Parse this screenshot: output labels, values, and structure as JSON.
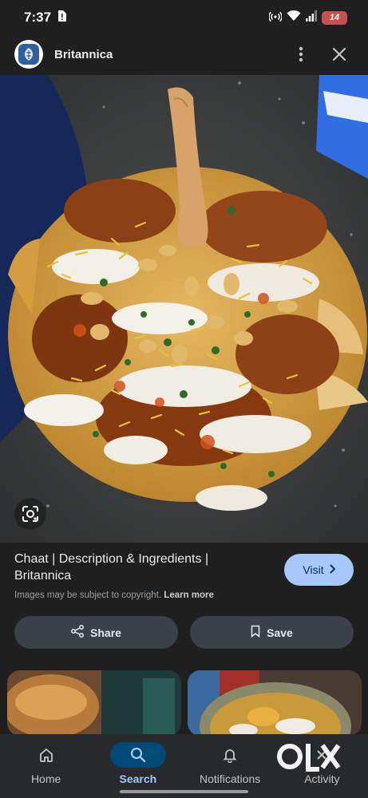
{
  "status_bar": {
    "time": "7:37",
    "battery_level": "14"
  },
  "header": {
    "site_name": "Britannica"
  },
  "result": {
    "title": "Chaat | Description & Ingredients | Britannica",
    "visit_label": "Visit",
    "copyright_text": "Images may be subject to copyright.",
    "learn_more_label": "Learn more"
  },
  "actions": {
    "share_label": "Share",
    "save_label": "Save"
  },
  "bottom_nav": {
    "items": [
      {
        "label": "Home",
        "icon": "home-icon"
      },
      {
        "label": "Search",
        "icon": "search-icon",
        "active": true
      },
      {
        "label": "Notifications",
        "icon": "bell-icon"
      },
      {
        "label": "Activity",
        "icon": "activity-icon"
      }
    ]
  },
  "watermark": {
    "text": "OLX"
  },
  "colors": {
    "background": "#1f1f1f",
    "visit_button": "#a8c7fa",
    "action_button": "#3c4049",
    "active_nav": "#004a77",
    "battery": "#c95050"
  }
}
